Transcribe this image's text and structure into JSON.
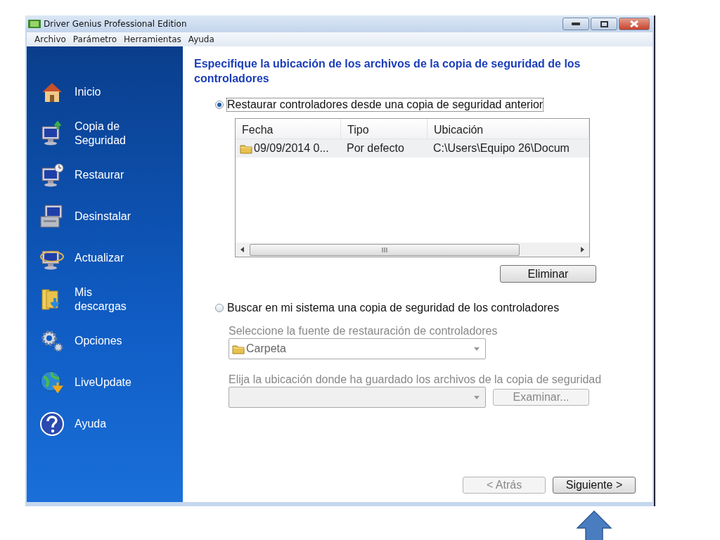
{
  "window": {
    "title": "Driver Genius Professional Edition"
  },
  "menu": [
    "Archivo",
    "Parámetro",
    "Herramientas",
    "Ayuda"
  ],
  "sidebar": {
    "items": [
      {
        "label": "Inicio",
        "kind": "home"
      },
      {
        "label": "Copia de Seguridad",
        "kind": "backup"
      },
      {
        "label": "Restaurar",
        "kind": "restore"
      },
      {
        "label": "Desinstalar",
        "kind": "uninstall"
      },
      {
        "label": "Actualizar",
        "kind": "update"
      },
      {
        "label": "Mis descargas",
        "kind": "downloads"
      },
      {
        "label": "Opciones",
        "kind": "options"
      },
      {
        "label": "LiveUpdate",
        "kind": "liveupdate"
      },
      {
        "label": "Ayuda",
        "kind": "help"
      }
    ]
  },
  "content": {
    "heading": "Especifique la ubicación de los archivos de la copia de seguridad de los controladores",
    "restore_option": {
      "label": "Restaurar controladores desde una copia de seguridad anterior",
      "selected": true
    },
    "table": {
      "columns": [
        "Fecha",
        "Tipo",
        "Ubicación"
      ],
      "rows": [
        [
          "09/09/2014 0...",
          "Por defecto",
          "C:\\Users\\Equipo 26\\Docum"
        ]
      ]
    },
    "delete_button": {
      "label": "Eliminar",
      "disabled": false
    },
    "search_option": {
      "label": "Buscar en mi sistema una copia de seguridad de los controladores",
      "selected": false
    },
    "source_label": "Seleccione la fuente de restauración de controladores",
    "source_select": {
      "value": "Carpeta",
      "disabled": true
    },
    "location_label": "Elija la ubicación donde ha guardado los archivos de la copia de seguridad",
    "location_select": {
      "disabled": true
    },
    "browse_button": {
      "label": "Examinar...",
      "disabled": true
    }
  },
  "footer_buttons": [
    {
      "label": "< Atrás",
      "disabled": true
    },
    {
      "label": "Siguiente >",
      "disabled": false
    }
  ]
}
